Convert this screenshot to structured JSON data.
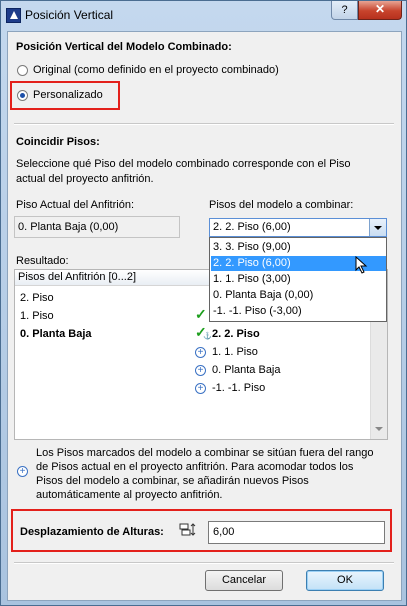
{
  "window": {
    "title": "Posición Vertical",
    "help_label": "?",
    "close_label": "✕"
  },
  "vertical_position": {
    "heading": "Posición Vertical del Modelo Combinado:",
    "option_original": "Original (como definido en el proyecto combinado)",
    "option_custom": "Personalizado",
    "selected": "custom"
  },
  "match_floors": {
    "heading": "Coincidir Pisos:",
    "description_line1": "Seleccione qué Piso del modelo combinado corresponde con el Piso",
    "description_line2": "actual del proyecto anfitrión.",
    "host_label": "Piso Actual del Anfitrión:",
    "host_value": "0. Planta Baja (0,00)",
    "merge_label": "Pisos del modelo a combinar:",
    "merge_value": "2. 2. Piso (6,00)",
    "dropdown_options": [
      "3. 3. Piso (9,00)",
      "2. 2. Piso (6,00)",
      "1. 1. Piso (3,00)",
      "0. Planta Baja (0,00)",
      "-1. -1. Piso (-3,00)"
    ],
    "dropdown_selected_index": 1
  },
  "result": {
    "label": "Resultado:",
    "column_host": "Pisos del Anfitrión [0...2]",
    "rows": [
      {
        "host": "2. Piso",
        "status": "",
        "merged": "",
        "bold": false
      },
      {
        "host": "1. Piso",
        "status": "check",
        "merged": "",
        "bold": false
      },
      {
        "host": "0. Planta Baja",
        "status": "check-anchor",
        "merged": "2. 2. Piso",
        "bold": true
      },
      {
        "host": "",
        "status": "plus",
        "merged": "1. 1. Piso",
        "bold": false
      },
      {
        "host": "",
        "status": "plus",
        "merged": "0. Planta Baja",
        "bold": false
      },
      {
        "host": "",
        "status": "plus",
        "merged": "-1. -1. Piso",
        "bold": false
      }
    ]
  },
  "note": {
    "line1": "Los Pisos marcados del modelo a combinar se sitúan fuera del rango",
    "line2": "de Pisos actual en el proyecto anfitrión. Para acomodar todos los",
    "line3": "Pisos del modelo a combinar, se añadirán nuevos Pisos",
    "line4": "automáticamente al proyecto anfitrión."
  },
  "height_offset": {
    "label": "Desplazamiento de Alturas:",
    "value": "6,00"
  },
  "buttons": {
    "cancel": "Cancelar",
    "ok": "OK"
  },
  "colors": {
    "highlight_box": "#e3201b",
    "selection": "#3399ff",
    "check": "#1d9e1d",
    "plus": "#3b72c4"
  }
}
